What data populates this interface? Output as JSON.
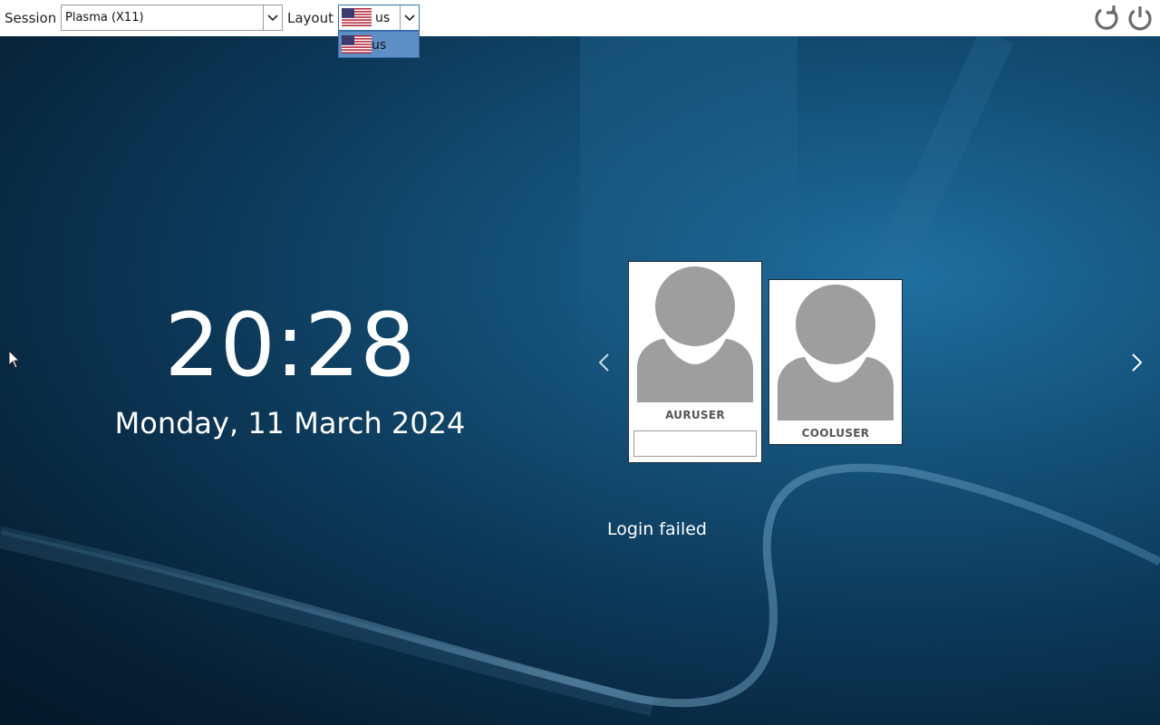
{
  "topbar": {
    "session_label": "Session",
    "session_value": "Plasma (X11)",
    "layout_label": "Layout",
    "layout_value": "us",
    "layout_options": [
      "us"
    ],
    "reboot_icon": "reboot-icon",
    "shutdown_icon": "power-icon"
  },
  "clock": {
    "time": "20:28",
    "date": "Monday, 11 March 2024"
  },
  "users": [
    {
      "name": "AURUSER",
      "selected": true,
      "password": ""
    },
    {
      "name": "COOLUSER",
      "selected": false
    }
  ],
  "status": {
    "message": "Login failed"
  },
  "colors": {
    "dropdown_highlight": "#5d8fc6",
    "avatar_gray": "#9e9e9e",
    "background_dark": "#061f33",
    "background_light": "#1f6fa0"
  }
}
